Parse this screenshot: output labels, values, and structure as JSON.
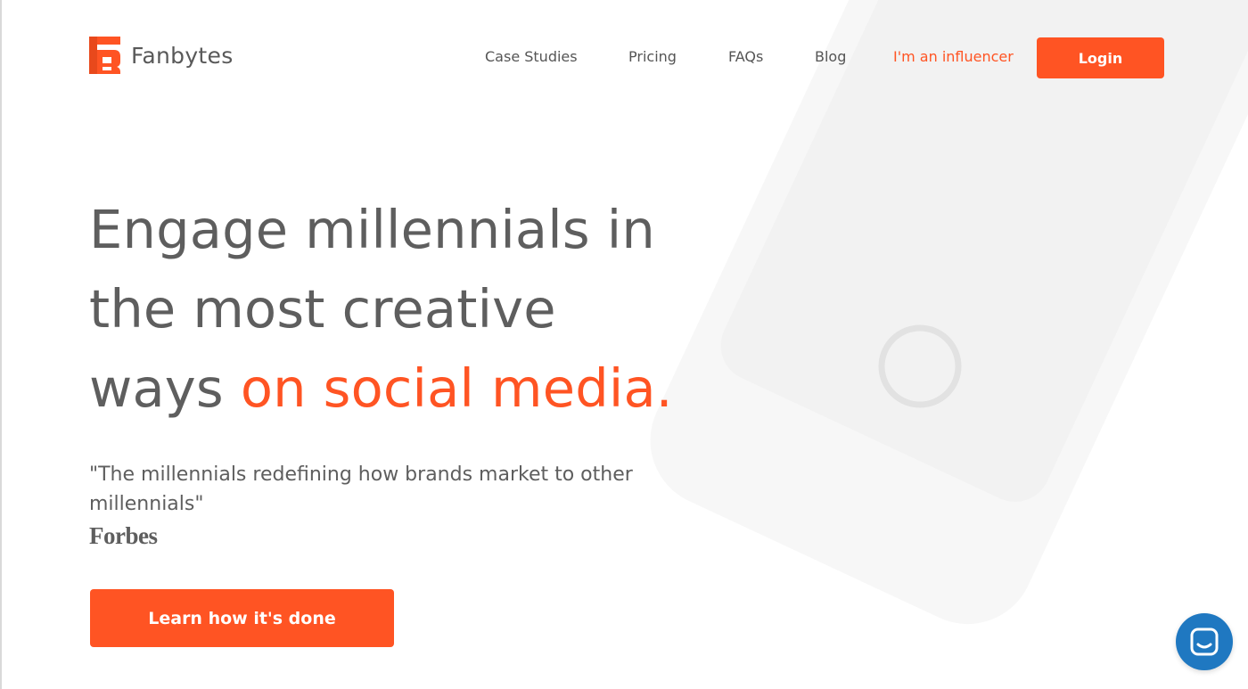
{
  "brand": {
    "name": "Fanbytes",
    "accent_color": "#ff5423",
    "text_color": "#5e5e5e"
  },
  "nav": {
    "case_studies": "Case Studies",
    "pricing": "Pricing",
    "faqs": "FAQs",
    "blog": "Blog",
    "influencer": "I'm an influencer",
    "login": "Login"
  },
  "hero": {
    "title_line1": "Engage millennials in",
    "title_line2": "the most creative",
    "title_line3_prefix": "ways ",
    "title_line3_accent": "on social media.",
    "quote": "\"The millennials redefining how brands market to other millennials\"",
    "quote_source": "Forbes",
    "cta": "Learn how it's done"
  },
  "chat": {
    "icon": "chat-bubble-icon",
    "color": "#1f78c1"
  },
  "decor": {
    "phone_icon": "phone-illustration",
    "phone_body_color": "#f7f7f7",
    "phone_screen_color": "#f2f2f2"
  }
}
